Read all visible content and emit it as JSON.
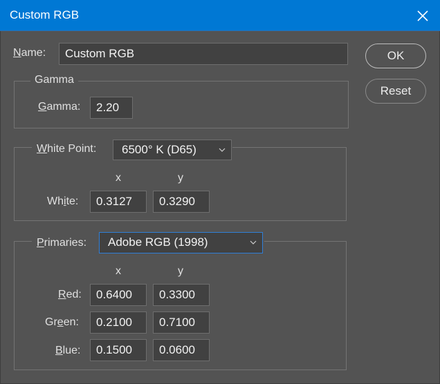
{
  "window": {
    "title": "Custom RGB"
  },
  "name": {
    "label_u": "N",
    "label_rest": "ame:",
    "value": "Custom RGB"
  },
  "buttons": {
    "ok": "OK",
    "reset": "Reset"
  },
  "gamma": {
    "group_title": "Gamma",
    "label_u": "G",
    "label_rest": "amma:",
    "value": "2.20"
  },
  "white_point": {
    "label_u": "W",
    "label_rest": "hite Point:",
    "selected": "6500° K (D65)",
    "col_x": "x",
    "col_y": "y",
    "row_label_pre": "Wh",
    "row_label_u": "i",
    "row_label_post": "te:",
    "x": "0.3127",
    "y": "0.3290"
  },
  "primaries": {
    "label_u": "P",
    "label_rest": "rimaries:",
    "selected": "Adobe RGB (1998)",
    "col_x": "x",
    "col_y": "y",
    "red": {
      "label_u": "R",
      "label_rest": "ed:",
      "x": "0.6400",
      "y": "0.3300"
    },
    "green": {
      "label_pre": "Gr",
      "label_u": "e",
      "label_post": "en:",
      "x": "0.2100",
      "y": "0.7100"
    },
    "blue": {
      "label_u": "B",
      "label_rest": "lue:",
      "x": "0.1500",
      "y": "0.0600"
    }
  },
  "colors": {
    "titlebar": "#0078d4",
    "background": "#535353",
    "field": "#414141",
    "focus": "#2f7fd8"
  }
}
